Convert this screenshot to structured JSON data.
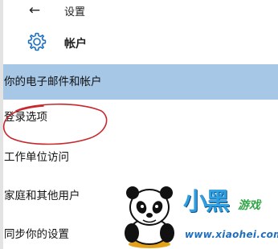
{
  "topbar": {
    "back_icon": "arrow-left-icon",
    "title": "设置"
  },
  "section": {
    "icon": "gear-icon",
    "title": "帐户"
  },
  "nav": {
    "items": [
      {
        "label": "你的电子邮件和帐户",
        "selected": true
      },
      {
        "label": "登录选项",
        "selected": false,
        "annotated": true
      },
      {
        "label": "工作单位访问",
        "selected": false
      },
      {
        "label": "家庭和其他用户",
        "selected": false
      },
      {
        "label": "同步你的设置",
        "selected": false
      }
    ]
  },
  "annotation": {
    "shape": "hand-drawn-ellipse",
    "color": "#c8282d"
  },
  "watermark": {
    "brand": "小黑",
    "tagline": "游戏",
    "url": "www.xiaohei.com",
    "mascot": "panda"
  },
  "colors": {
    "selected_bg": "#a7c7e7",
    "accent": "#1b6fc4",
    "annotation_red": "#c8282d"
  }
}
